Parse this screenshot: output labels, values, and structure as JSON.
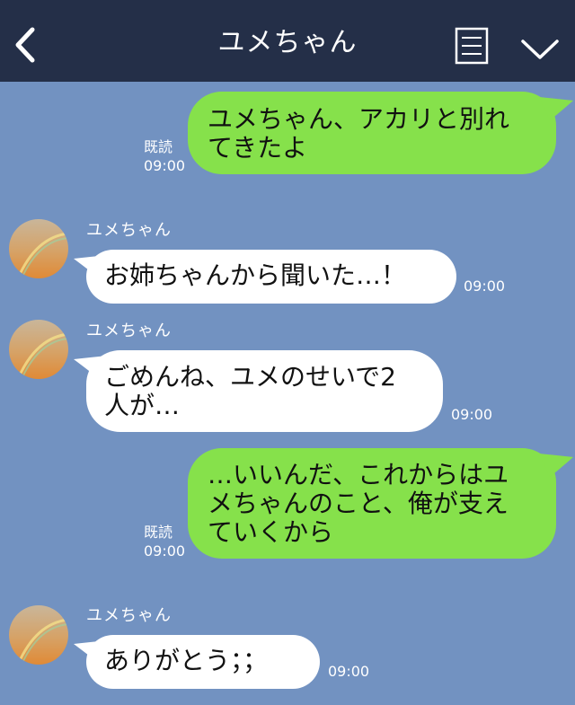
{
  "header": {
    "title": "ユメちゃん"
  },
  "messages": [
    {
      "direction": "out",
      "text_lines": [
        "ユメちゃん、アカリと別れ",
        "てきたよ"
      ],
      "read_label": "既読",
      "time": "09:00"
    },
    {
      "direction": "in",
      "sender": "ユメちゃん",
      "text_lines": [
        "お姉ちゃんから聞いた…！"
      ],
      "time": "09:00"
    },
    {
      "direction": "in",
      "sender": "ユメちゃん",
      "text_lines": [
        "ごめんね、ユメのせいで2",
        "人が…"
      ],
      "time": "09:00"
    },
    {
      "direction": "out",
      "text_lines": [
        "…いいんだ、これからはユ",
        "メちゃんのこと、俺が支え",
        "ていくから"
      ],
      "read_label": "既読",
      "time": "09:00"
    },
    {
      "direction": "in",
      "sender": "ユメちゃん",
      "text_lines": [
        "ありがとう；；"
      ],
      "time": "09:00"
    }
  ],
  "colors": {
    "background": "#7292c1",
    "header": "#242f48",
    "outgoing_bubble": "#86e14b",
    "incoming_bubble": "#ffffff"
  },
  "icons": [
    "chevron-left-icon",
    "note-icon",
    "chevron-down-icon",
    "avatar"
  ]
}
